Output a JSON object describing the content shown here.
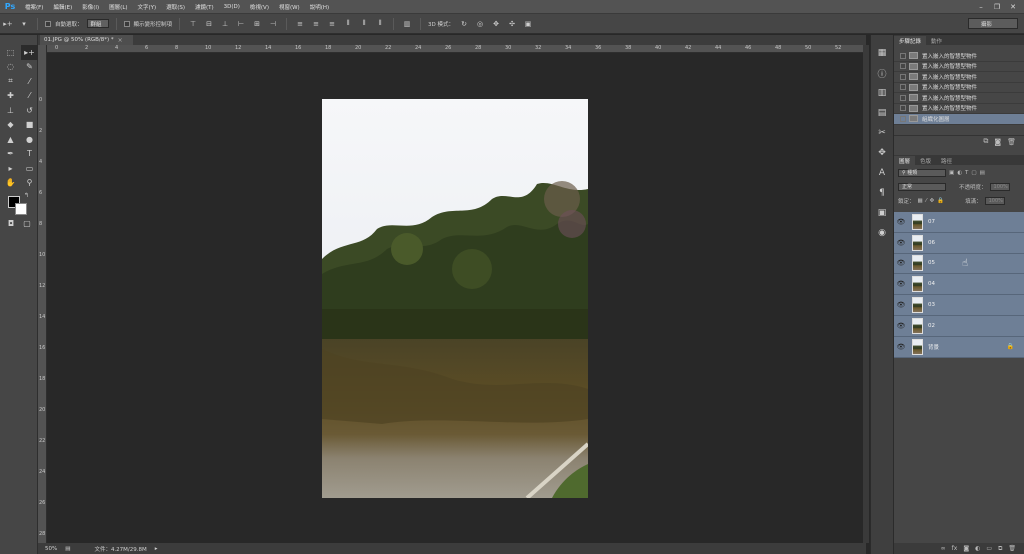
{
  "app": {
    "logo": "Ps"
  },
  "menu": [
    "檔案(F)",
    "編輯(E)",
    "影像(I)",
    "圖層(L)",
    "文字(Y)",
    "選取(S)",
    "濾鏡(T)",
    "3D(D)",
    "檢視(V)",
    "視窗(W)",
    "說明(H)"
  ],
  "options": {
    "auto_select_label": "自動選取：",
    "auto_select_value": "群組",
    "transform_label": "顯示變形控制項",
    "mode_3d_label": "3D 模式：",
    "workspace": "攝影"
  },
  "document": {
    "tab_title": "01.JPG @ 50% (RGB/8*) *",
    "close": "×",
    "zoom": "50%",
    "doc_size": "文件：4.27M/29.8M"
  },
  "ruler": {
    "top": [
      "0",
      "2",
      "4",
      "6",
      "8",
      "10",
      "12",
      "14",
      "16",
      "18",
      "20",
      "22",
      "24",
      "26",
      "28",
      "30",
      "32",
      "34",
      "36",
      "38",
      "40",
      "42",
      "44",
      "46",
      "48",
      "50",
      "52"
    ],
    "left": [
      "0",
      "2",
      "4",
      "6",
      "8",
      "10",
      "12",
      "14",
      "16",
      "18",
      "20",
      "22",
      "24",
      "26",
      "28"
    ]
  },
  "history": {
    "tabs": [
      "步驟記錄",
      "動作"
    ],
    "items": [
      "置入嵌入的智慧型物件",
      "置入嵌入的智慧型物件",
      "置入嵌入的智慧型物件",
      "置入嵌入的智慧型物件",
      "置入嵌入的智慧型物件",
      "置入嵌入的智慧型物件",
      "組織化圖層"
    ]
  },
  "layers": {
    "tabs": [
      "圖層",
      "色版",
      "路徑"
    ],
    "filter_kind": "種類",
    "blend_mode": "正常",
    "opacity_label": "不透明度：",
    "opacity_value": "100%",
    "lock_label": "鎖定：",
    "fill_label": "填滿：",
    "fill_value": "100%",
    "items": [
      "07",
      "06",
      "05",
      "04",
      "03",
      "02",
      "背景"
    ]
  },
  "colors": {
    "accent": "#31a8ff",
    "selection": "#6e7f96"
  }
}
